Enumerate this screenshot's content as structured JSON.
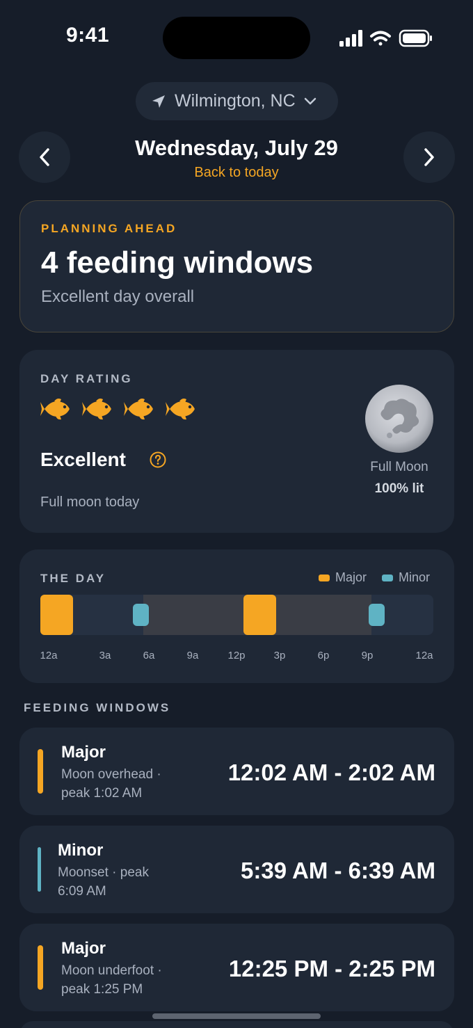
{
  "status": {
    "time": "9:41"
  },
  "location": {
    "label": "Wilmington, NC"
  },
  "date_nav": {
    "title": "Wednesday, July 29",
    "back_link": "Back to today"
  },
  "planning": {
    "eyebrow": "PLANNING AHEAD",
    "title": "4 feeding windows",
    "subtitle": "Excellent day overall"
  },
  "rating": {
    "eyebrow": "DAY RATING",
    "stars": 4,
    "stars_max": 4,
    "label": "Excellent",
    "note": "Full moon today",
    "moon_phase": "Full Moon",
    "moon_lit": "100% lit"
  },
  "day": {
    "eyebrow": "THE DAY",
    "legend_major": "Major",
    "legend_minor": "Minor",
    "ticks": [
      "12a",
      "3a",
      "6a",
      "9a",
      "12p",
      "3p",
      "6p",
      "9p",
      "12a"
    ]
  },
  "feeding": {
    "title": "FEEDING WINDOWS",
    "windows": [
      {
        "type": "Major",
        "desc": "Moon overhead · peak 1:02 AM",
        "time": "12:02 AM - 2:02 AM"
      },
      {
        "type": "Minor",
        "desc": "Moonset · peak 6:09 AM",
        "time": "5:39 AM - 6:39 AM"
      },
      {
        "type": "Major",
        "desc": "Moon underfoot · peak 1:25 PM",
        "time": "12:25 PM - 2:25 PM"
      }
    ]
  },
  "colors": {
    "major": "#f5a623",
    "minor": "#5fb3c4",
    "background": "#161d29",
    "card": "#1f2836"
  }
}
